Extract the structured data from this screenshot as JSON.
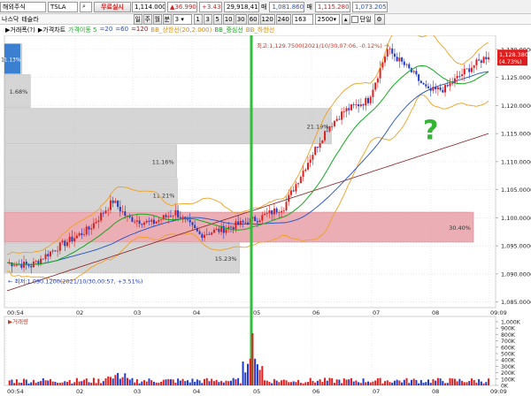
{
  "toolbar": {
    "market_label": "해외주식",
    "symbol": "TSLA",
    "trade_status": "무료실시",
    "price": "1,114.0000",
    "change": "▲36.9900",
    "change_pct": "+3.43%",
    "volume": "29,918,417",
    "bid_label": "매",
    "bid": "1,081.8600",
    "ask_label": "매",
    "ask": "1,115.2800",
    "ask_size": "1,073.2050",
    "period_buttons": [
      "일",
      "주",
      "월",
      "분"
    ],
    "minute_value": "3",
    "interval_buttons": [
      "1",
      "3",
      "5",
      "10",
      "30",
      "60",
      "120",
      "240"
    ],
    "count_value": "163",
    "bars_value": "2500",
    "single_label": "단일"
  },
  "toolbar2": {
    "exchange": "나스닥",
    "name": "테슬라"
  },
  "legend": {
    "items": [
      {
        "text": "▶거래폭(?)",
        "color": "#000000"
      },
      {
        "text": "▶가격차트",
        "color": "#000000"
      },
      {
        "text": "가격이동 5",
        "color": "#13a81d"
      },
      {
        "text": "=20",
        "color": "#1e50c8"
      },
      {
        "text": "=60",
        "color": "#1e50c8"
      },
      {
        "text": "=120",
        "color": "#8b1a1a"
      },
      {
        "text": "BB_상한선(20,2.000)",
        "color": "#e08a00"
      },
      {
        "text": "BB_중심선",
        "color": "#13a81d"
      },
      {
        "text": "BB_하한선",
        "color": "#e08a00"
      }
    ]
  },
  "colors": {
    "up": "#e01e1e",
    "down": "#1e3cc8",
    "ma5": "#13a81d",
    "ma20": "#1e50c8",
    "ma120": "#8b1a1a",
    "bb": "#f0a020",
    "vertical_line": "#2fbf3a",
    "volume_profile": "#c8c8c8",
    "volume_profile_highlight": "#e8a0a8",
    "question_mark": "#33b533",
    "price_tag": "#e01e1e"
  },
  "chart_data": [
    {
      "type": "line",
      "subtype": "candlestick",
      "y_ticks": [
        1085,
        1090,
        1095,
        1100,
        1105,
        1110,
        1115,
        1120,
        1125,
        1130
      ],
      "y_tick_labels": [
        "1,085.0000",
        "1,090.0000",
        "1,095.0000",
        "1,100.0000",
        "1,105.0000",
        "1,110.0000",
        "1,115.0000",
        "1,120.0000",
        "1,125.0000",
        "1,130.0000"
      ],
      "ylim": [
        1084,
        1132.5
      ],
      "x_tick_labels": [
        "00:54",
        "02",
        "03",
        "04",
        "05",
        "06",
        "07",
        "08",
        "09:09"
      ],
      "current_price_tag": "1,128.3800",
      "current_price_pct": "(4.73%)",
      "current_price": 1128.38,
      "annotation_high": "최고:1,129.7500(2021/10/30,07:06, -0.12%)",
      "annotation_low": "최저:1,090.1200(2021/10/30,00:57, +3.51%)",
      "volume_profile": [
        {
          "price_low": 1125.5,
          "price_high": 1131,
          "pct_label": "1.13%",
          "pct": 1.13
        },
        {
          "price_low": 1119.5,
          "price_high": 1125.5,
          "pct_label": "1.68%",
          "pct": 1.68
        },
        {
          "price_low": 1113,
          "price_high": 1119.5,
          "pct_label": "21.19%",
          "pct": 21.19
        },
        {
          "price_low": 1107,
          "price_high": 1113,
          "pct_label": "11.16%",
          "pct": 11.16
        },
        {
          "price_low": 1101,
          "price_high": 1107,
          "pct_label": "11.21%",
          "pct": 11.21
        },
        {
          "price_low": 1095.5,
          "price_high": 1101,
          "pct_label": "30.40%",
          "pct": 30.4
        },
        {
          "price_low": 1090,
          "price_high": 1095.5,
          "pct_label": "15.23%",
          "pct": 15.23
        }
      ],
      "annotation_mark": "?"
    },
    {
      "type": "bar",
      "title": "거래량",
      "y_tick_labels": [
        "1,000K",
        "900K",
        "800K",
        "700K",
        "600K",
        "500K",
        "400K",
        "300K",
        "200K",
        "100K",
        "0K"
      ],
      "ylim": [
        0,
        1000
      ]
    }
  ]
}
